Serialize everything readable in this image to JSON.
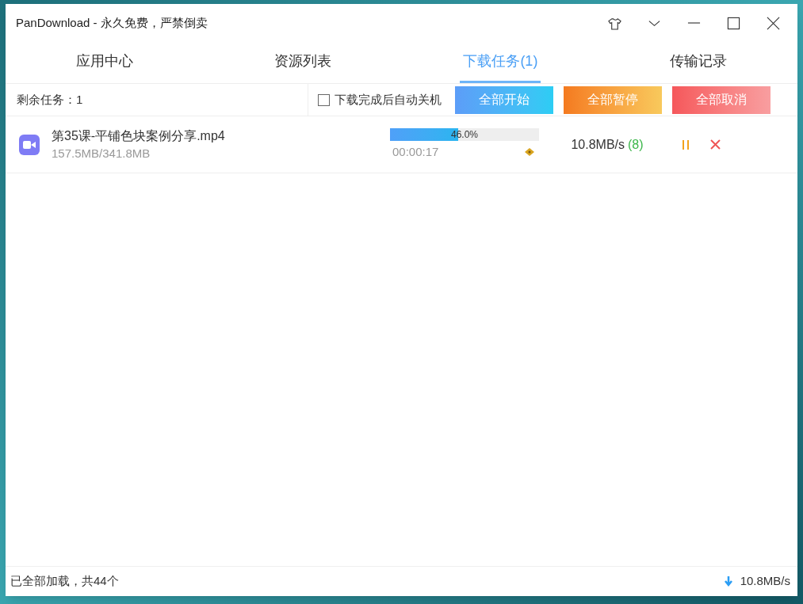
{
  "window": {
    "title": "PanDownload - 永久免费，严禁倒卖"
  },
  "tabs": [
    {
      "label": "应用中心",
      "selected": false
    },
    {
      "label": "资源列表",
      "selected": false
    },
    {
      "label": "下载任务(1)",
      "selected": true
    },
    {
      "label": "传输记录",
      "selected": false
    }
  ],
  "toolbar": {
    "remaining": "剩余任务：1",
    "auto_shutdown": {
      "label": "下载完成后自动关机",
      "checked": false
    },
    "buttons": [
      {
        "label": "全部开始",
        "kind": "start"
      },
      {
        "label": "全部暂停",
        "kind": "pause"
      },
      {
        "label": "全部取消",
        "kind": "cancel"
      }
    ]
  },
  "tasks": [
    {
      "name": "第35课-平铺色块案例分享.mp4",
      "size": "157.5MB/341.8MB",
      "level": 0.46,
      "percent": "46.0%",
      "elapsed": "00:00:17",
      "speed": "10.8MB/s",
      "connections": "(8)"
    }
  ],
  "status_bar": {
    "summary": "已全部加载，共44个",
    "speed": "10.8MB/s"
  }
}
